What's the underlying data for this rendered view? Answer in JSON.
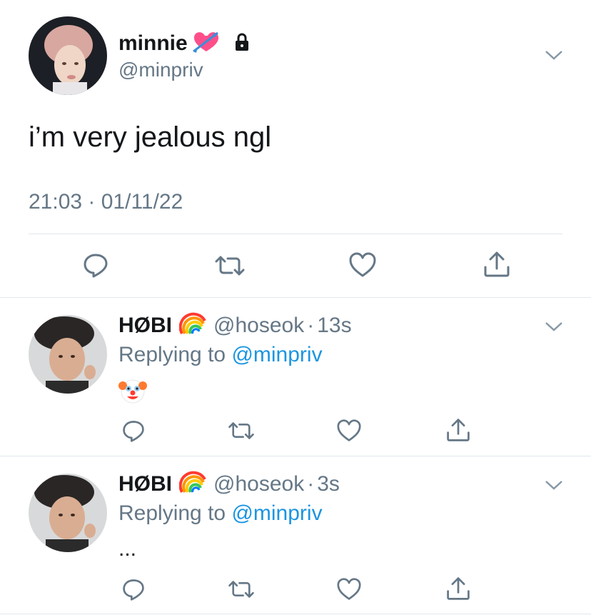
{
  "main_tweet": {
    "display_name": "minnie",
    "name_emoji": "heart-with-arrow",
    "protected_icon": "lock-icon",
    "handle": "@minpriv",
    "text": "i’m very jealous ngl",
    "timestamp": "21:03 · 01/11/22"
  },
  "actions": [
    "reply-icon",
    "retweet-icon",
    "like-icon",
    "share-icon"
  ],
  "replies": [
    {
      "display_name": "HØBI",
      "name_emoji": "rainbow",
      "handle": "@hoseok",
      "separator": "·",
      "age": "13s",
      "replying_prefix": "Replying to",
      "replying_to": "@minpriv",
      "text": "",
      "content_emoji": "clown-face"
    },
    {
      "display_name": "HØBI",
      "name_emoji": "rainbow",
      "handle": "@hoseok",
      "separator": "·",
      "age": "3s",
      "replying_prefix": "Replying to",
      "replying_to": "@minpriv",
      "text": "..."
    }
  ],
  "colors": {
    "link": "#1b95e0",
    "muted": "#657786",
    "divider": "#e1e8ed",
    "icon": "#657786"
  }
}
